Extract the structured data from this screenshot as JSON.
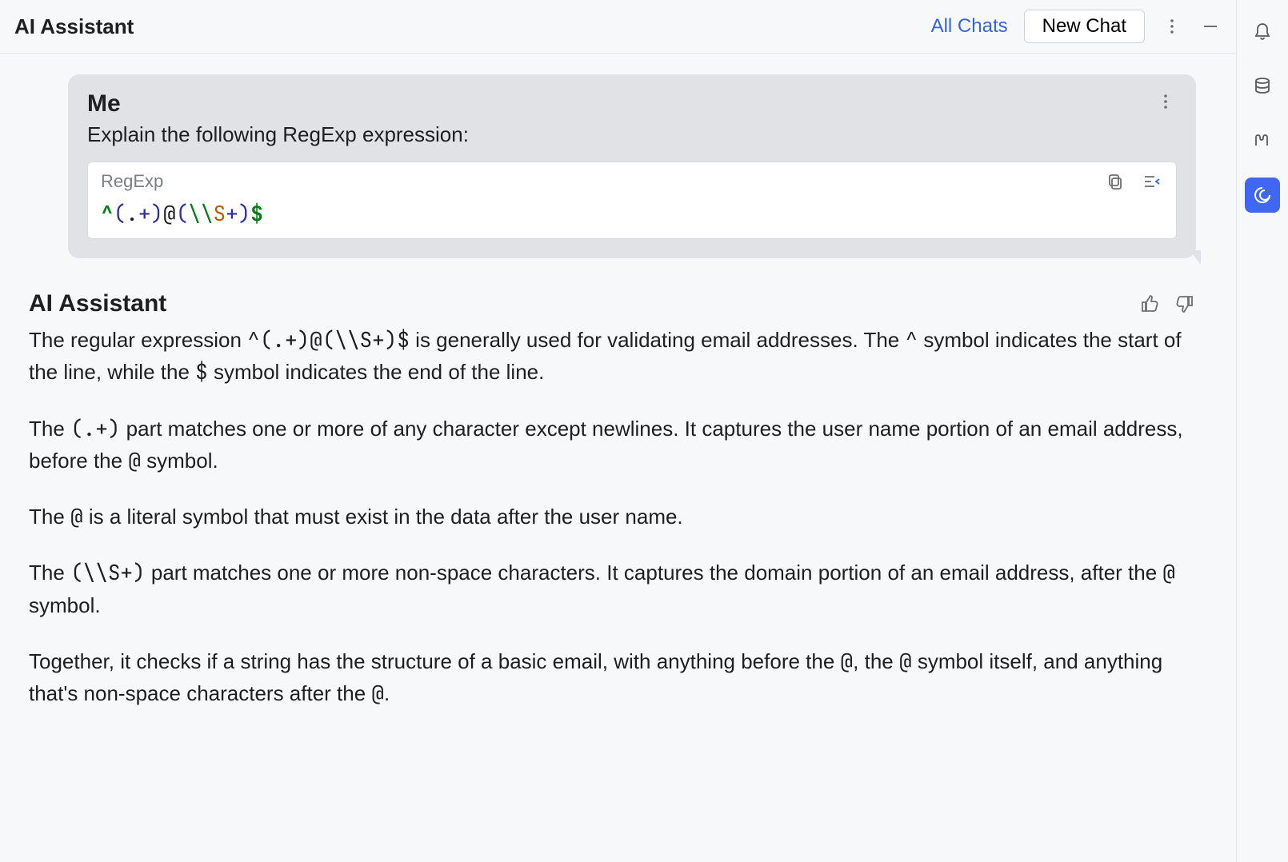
{
  "header": {
    "title": "AI Assistant",
    "all_chats": "All Chats",
    "new_chat": "New Chat"
  },
  "sidebar": {
    "items": [
      {
        "name": "notifications-icon"
      },
      {
        "name": "database-icon"
      },
      {
        "name": "m-icon"
      },
      {
        "name": "ai-swirl-icon",
        "active": true
      }
    ]
  },
  "chat": {
    "user": {
      "sender": "Me",
      "text": "Explain the following RegExp expression:",
      "code": {
        "lang_label": "RegExp",
        "tokens": [
          {
            "cls": "tok-anchor",
            "t": "^"
          },
          {
            "cls": "tok-group",
            "t": "("
          },
          {
            "cls": "tok-plain",
            "t": "."
          },
          {
            "cls": "tok-group",
            "t": "+)"
          },
          {
            "cls": "tok-plain",
            "t": "@"
          },
          {
            "cls": "tok-group",
            "t": "("
          },
          {
            "cls": "tok-esc",
            "t": "\\\\"
          },
          {
            "cls": "tok-class",
            "t": "S"
          },
          {
            "cls": "tok-group",
            "t": "+)"
          },
          {
            "cls": "tok-end",
            "t": "$"
          }
        ],
        "plain": "^(.+)@(\\\\S+)$"
      }
    },
    "assistant": {
      "sender": "AI Assistant",
      "para1_a": "The regular expression ",
      "para1_code1": "^(.+)@(\\\\S+)$",
      "para1_b": " is generally used for validating email addresses. The ",
      "para1_code2": "^",
      "para1_c": " symbol indicates the start of the line, while the ",
      "para1_code3": "$",
      "para1_d": " symbol indicates the end of the line.",
      "para2_a": "The ",
      "para2_code1": "(.+)",
      "para2_b": " part matches one or more of any character except newlines. It captures the user name portion of an email address, before the ",
      "para2_code2": "@",
      "para2_c": " symbol.",
      "para3_a": "The ",
      "para3_code1": "@",
      "para3_b": " is a literal symbol that must exist in the data after the user name.",
      "para4_a": "The ",
      "para4_code1": "(\\\\S+)",
      "para4_b": " part matches one or more non-space characters. It captures the domain portion of an email address, after the ",
      "para4_code2": "@",
      "para4_c": " symbol.",
      "para5_a": "Together, it checks if a string has the structure of a basic email, with anything before the ",
      "para5_code1": "@",
      "para5_b": ", the ",
      "para5_code2": "@",
      "para5_c": " symbol itself, and anything that's non-space characters after the ",
      "para5_code3": "@",
      "para5_d": "."
    }
  }
}
